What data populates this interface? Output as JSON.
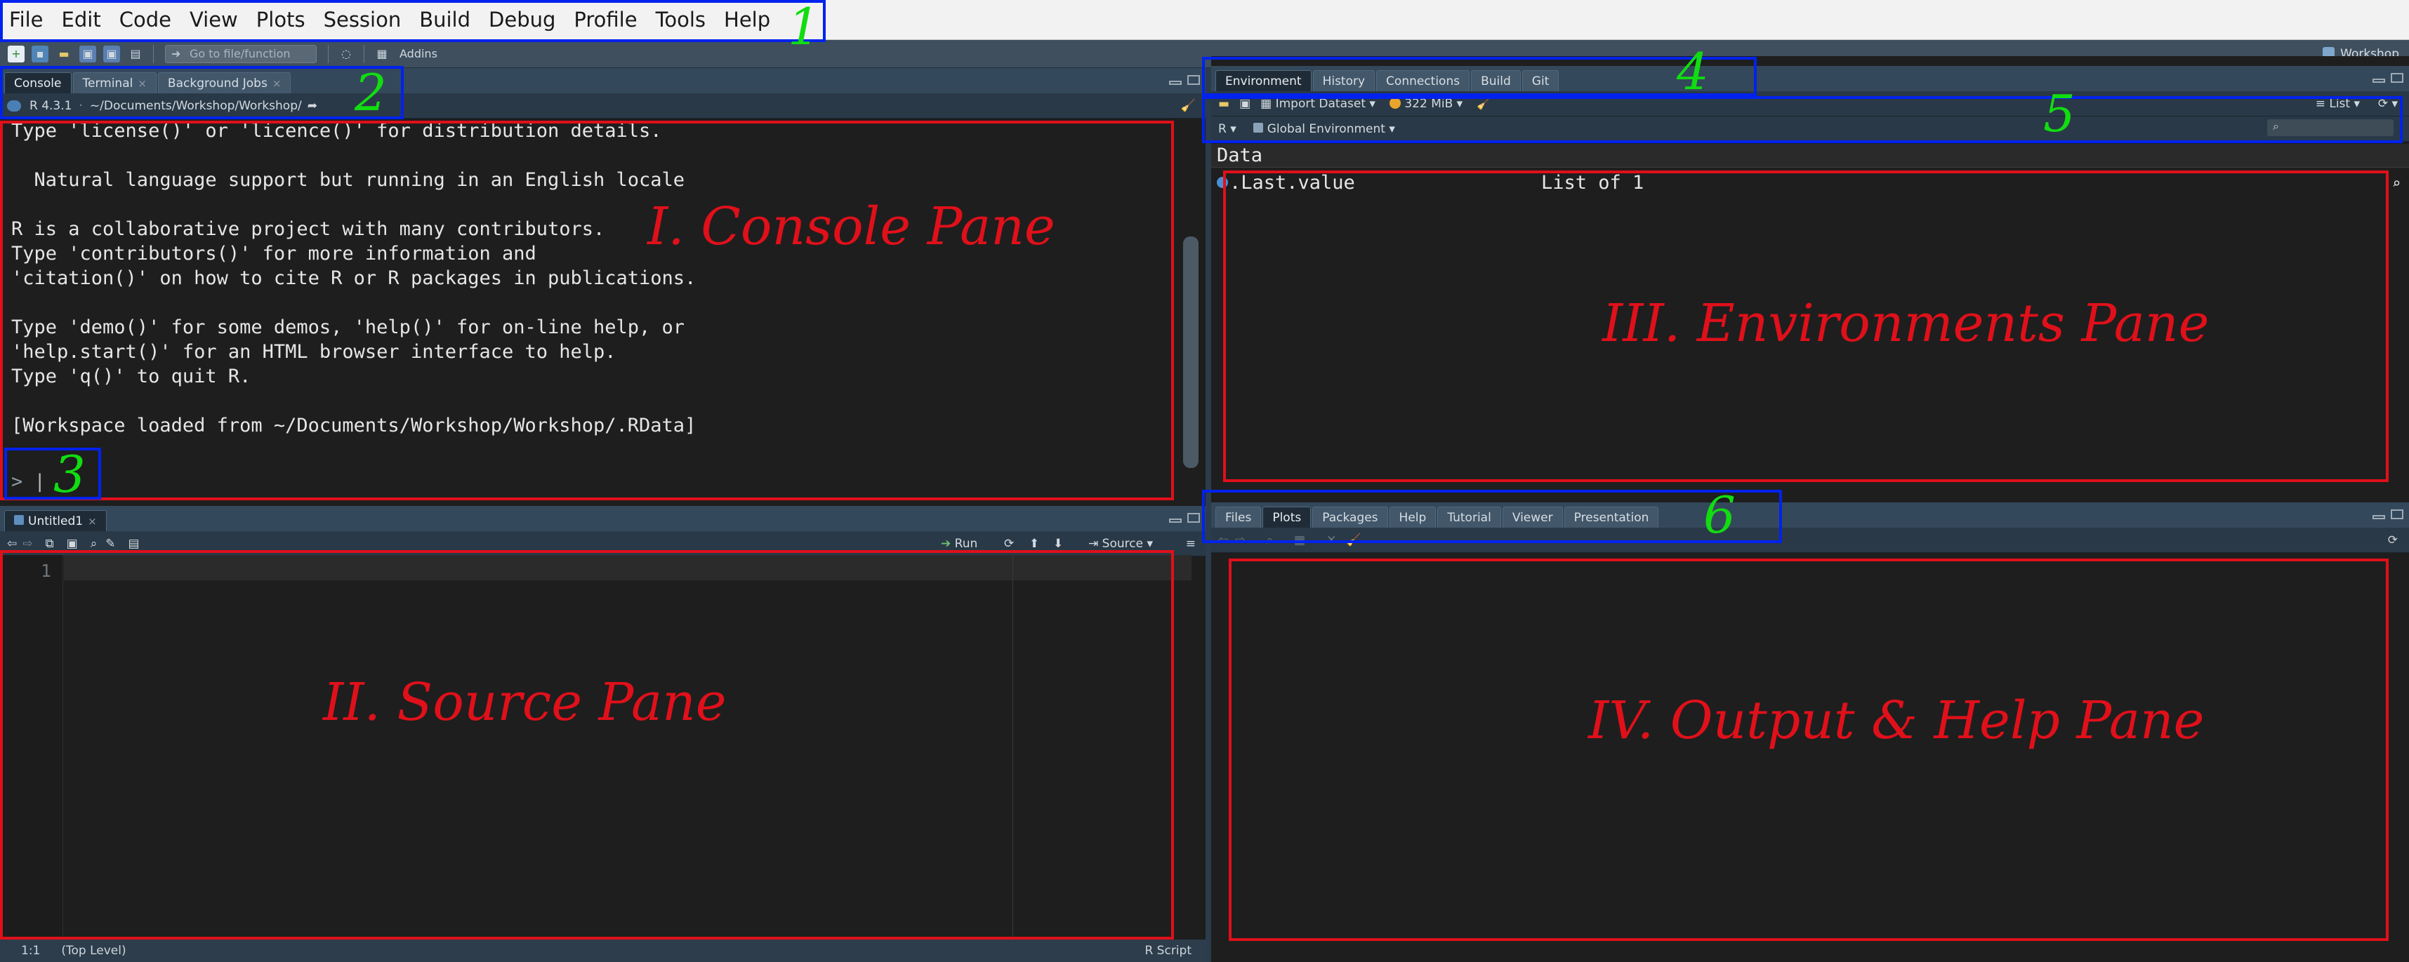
{
  "menu": [
    "File",
    "Edit",
    "Code",
    "View",
    "Plots",
    "Session",
    "Build",
    "Debug",
    "Profile",
    "Tools",
    "Help"
  ],
  "toolbar": {
    "goto_placeholder": "Go to file/function",
    "addins": "Addins",
    "project": "Workshop"
  },
  "console": {
    "tabs": [
      "Console",
      "Terminal",
      "Background Jobs"
    ],
    "r_version": "R 4.3.1",
    "path": "~/Documents/Workshop/Workshop/",
    "text": "Type 'license()' or 'licence()' for distribution details.\n\n  Natural language support but running in an English locale\n\nR is a collaborative project with many contributors.\nType 'contributors()' for more information and\n'citation()' on how to cite R or R packages in publications.\n\nType 'demo()' for some demos, 'help()' for on-line help, or\n'help.start()' for an HTML browser interface to help.\nType 'q()' to quit R.\n\n[Workspace loaded from ~/Documents/Workshop/Workshop/.RData]",
    "prompt": ">"
  },
  "source": {
    "tab": "Untitled1",
    "run": "Run",
    "source_btn": "Source",
    "line_number": "1",
    "status_pos": "1:1",
    "status_scope": "(Top Level)",
    "status_type": "R Script"
  },
  "environment": {
    "tabs": [
      "Environment",
      "History",
      "Connections",
      "Build",
      "Git"
    ],
    "import_dataset": "Import Dataset",
    "memory": "322 MiB",
    "view_mode": "List",
    "lang": "R",
    "scope": "Global Environment",
    "section": "Data",
    "row_name": ".Last.value",
    "row_value": "List of  1"
  },
  "output": {
    "tabs": [
      "Files",
      "Plots",
      "Packages",
      "Help",
      "Tutorial",
      "Viewer",
      "Presentation"
    ],
    "active_tab": "Plots"
  },
  "annotations": {
    "n1": "1",
    "n2": "2",
    "n3": "3",
    "n4": "4",
    "n5": "5",
    "n6": "6",
    "console_label": "I. Console Pane",
    "source_label": "II. Source Pane",
    "env_label": "III. Environments Pane",
    "output_label": "IV. Output & Help Pane"
  },
  "colors": {
    "annotation_blue": "#0022ee",
    "annotation_red": "#e0101a",
    "annotation_green": "#11dd11"
  }
}
